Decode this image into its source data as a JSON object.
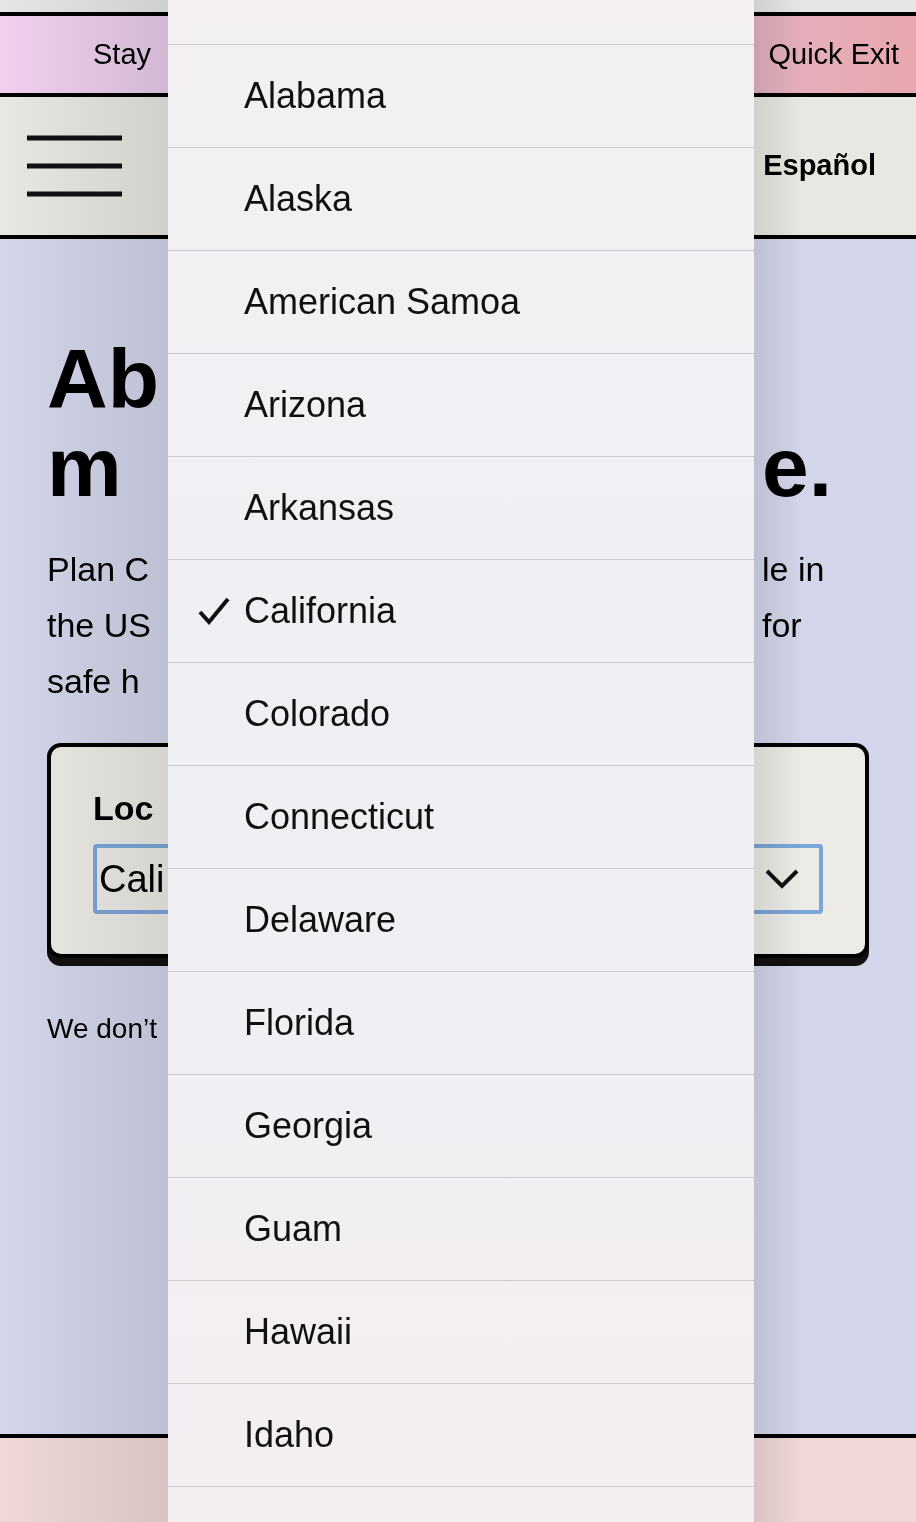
{
  "top_bar": {
    "left_text": "Stay",
    "quick_exit": "Quick Exit"
  },
  "header": {
    "language_link": "Español"
  },
  "hero": {
    "heading_left": [
      "Ab",
      "m"
    ],
    "heading_right": [
      "e."
    ],
    "body_left": [
      "Plan C",
      "the US",
      "safe h"
    ],
    "body_right": [
      "le in",
      "for"
    ]
  },
  "location_card": {
    "label": "Loc",
    "select_value": "Cali"
  },
  "note_left": "We don’t",
  "state_menu": {
    "options": [
      {
        "label": "Alabama",
        "selected": false
      },
      {
        "label": "Alaska",
        "selected": false
      },
      {
        "label": "American Samoa",
        "selected": false
      },
      {
        "label": "Arizona",
        "selected": false
      },
      {
        "label": "Arkansas",
        "selected": false
      },
      {
        "label": "California",
        "selected": true
      },
      {
        "label": "Colorado",
        "selected": false
      },
      {
        "label": "Connecticut",
        "selected": false
      },
      {
        "label": "Delaware",
        "selected": false
      },
      {
        "label": "Florida",
        "selected": false
      },
      {
        "label": "Georgia",
        "selected": false
      },
      {
        "label": "Guam",
        "selected": false
      },
      {
        "label": "Hawaii",
        "selected": false
      },
      {
        "label": "Idaho",
        "selected": false
      }
    ]
  }
}
